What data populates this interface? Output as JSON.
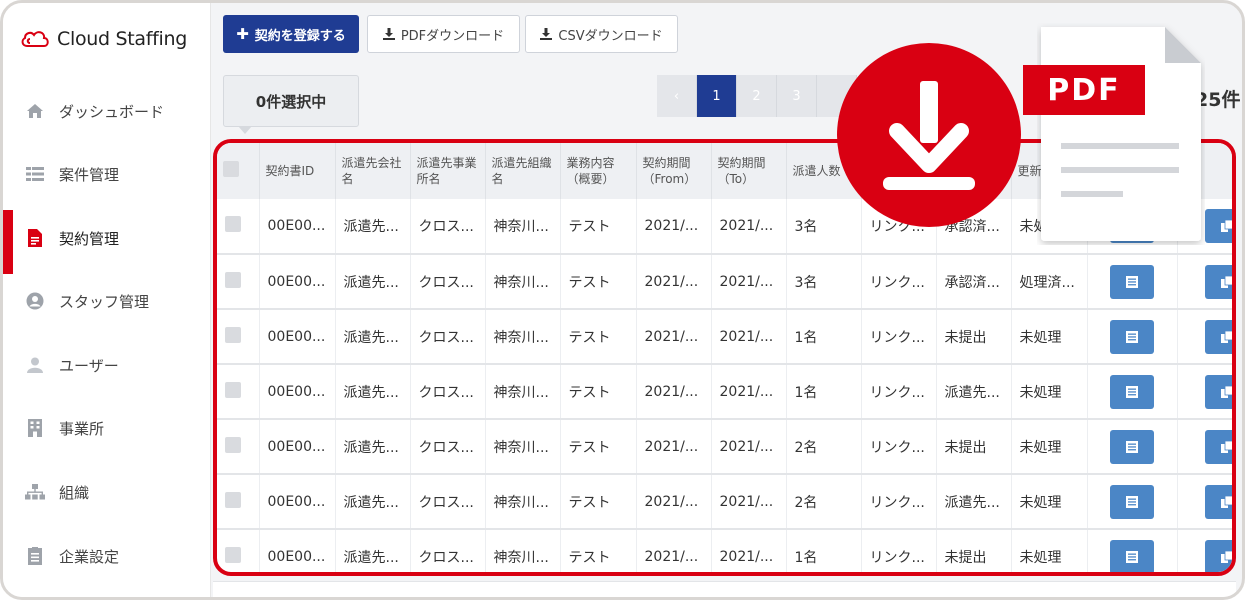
{
  "app": {
    "logo_text": "Cloud Staffing"
  },
  "sidebar": {
    "items": [
      {
        "label": "ダッシュボード",
        "icon": "home-icon"
      },
      {
        "label": "案件管理",
        "icon": "list-icon"
      },
      {
        "label": "契約管理",
        "icon": "document-icon",
        "active": true
      },
      {
        "label": "スタッフ管理",
        "icon": "staff-icon"
      },
      {
        "label": "ユーザー",
        "icon": "user-icon"
      },
      {
        "label": "事業所",
        "icon": "building-icon"
      },
      {
        "label": "組織",
        "icon": "org-chart-icon"
      },
      {
        "label": "企業設定",
        "icon": "settings-doc-icon"
      }
    ]
  },
  "toolbar": {
    "register_label": "契約を登録する",
    "pdf_download_label": "PDFダウンロード",
    "csv_download_label": "CSVダウンロード"
  },
  "selection": {
    "selected_text": "0件選択中"
  },
  "pagination": {
    "prev": "‹",
    "pages": [
      "1",
      "2",
      "3"
    ],
    "current": "1",
    "count_text": "25件"
  },
  "table": {
    "headers": [
      "",
      "契約書ID",
      "派遣先会社名",
      "派遣先事業所名",
      "派遣先組織名",
      "業務内容（概要）",
      "契約期間（From）",
      "契約期間（To）",
      "派遣人数",
      "",
      "",
      "更新処理",
      "",
      ""
    ],
    "rows": [
      [
        "00E00...",
        "派遣先...",
        "クロス...",
        "神奈川...",
        "テスト",
        "2021/...",
        "2021/...",
        "3名",
        "リンク...",
        "承認済...",
        "未処理"
      ],
      [
        "00E00...",
        "派遣先...",
        "クロス...",
        "神奈川...",
        "テスト",
        "2021/...",
        "2021/...",
        "3名",
        "リンク...",
        "承認済...",
        "処理済..."
      ],
      [
        "00E00...",
        "派遣先...",
        "クロス...",
        "神奈川...",
        "テスト",
        "2021/...",
        "2021/...",
        "1名",
        "リンク...",
        "未提出",
        "未処理"
      ],
      [
        "00E00...",
        "派遣先...",
        "クロス...",
        "神奈川...",
        "テスト",
        "2021/...",
        "2021/...",
        "1名",
        "リンク...",
        "派遣先...",
        "未処理"
      ],
      [
        "00E00...",
        "派遣先...",
        "クロス...",
        "神奈川...",
        "テスト",
        "2021/...",
        "2021/...",
        "2名",
        "リンク...",
        "未提出",
        "未処理"
      ],
      [
        "00E00...",
        "派遣先...",
        "クロス...",
        "神奈川...",
        "テスト",
        "2021/...",
        "2021/...",
        "2名",
        "リンク...",
        "派遣先...",
        "未処理"
      ],
      [
        "00E00...",
        "派遣先...",
        "クロス...",
        "神奈川...",
        "テスト",
        "2021/...",
        "2021/...",
        "1名",
        "リンク...",
        "未提出",
        "未処理"
      ]
    ]
  },
  "overlay": {
    "pdf_badge": "PDF",
    "download_icon": "download-arrow-icon",
    "document_icon": "pdf-file-icon"
  },
  "colors": {
    "brand_red": "#d90012",
    "primary_blue": "#1f3c93",
    "action_blue": "#4b86c6"
  }
}
